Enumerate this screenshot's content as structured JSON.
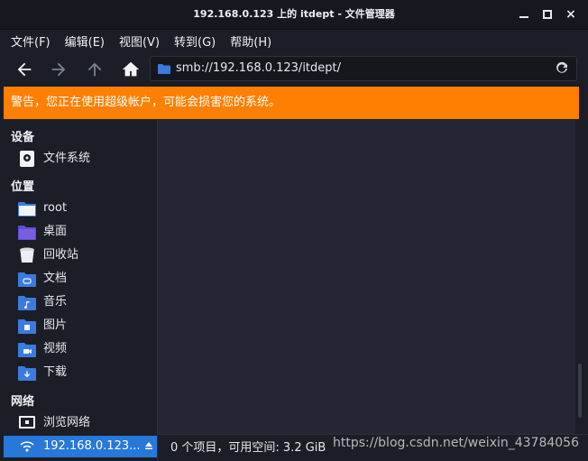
{
  "window": {
    "title": "192.168.0.123 上的 itdept - 文件管理器",
    "close_glyph": "×"
  },
  "menu": [
    {
      "label": "文件(F)"
    },
    {
      "label": "编辑(E)"
    },
    {
      "label": "视图(V)"
    },
    {
      "label": "转到(G)"
    },
    {
      "label": "帮助(H)"
    }
  ],
  "toolbar": {
    "back_icon": "arrow-left-icon",
    "forward_icon": "arrow-right-icon",
    "up_icon": "arrow-up-icon",
    "home_icon": "home-icon",
    "address": "smb://192.168.0.123/itdept/",
    "reload_icon": "reload-icon"
  },
  "warning": {
    "text": "警告，您正在使用超级帐户，可能会损害您的系统。",
    "color": "#fe7f02"
  },
  "sidebar": {
    "devices_title": "设备",
    "devices": [
      {
        "label": "文件系统",
        "icon": "drive-icon"
      }
    ],
    "places_title": "位置",
    "places": [
      {
        "label": "root",
        "icon": "home-folder-icon"
      },
      {
        "label": "桌面",
        "icon": "desktop-folder-icon"
      },
      {
        "label": "回收站",
        "icon": "trash-icon"
      },
      {
        "label": "文档",
        "icon": "documents-folder-icon"
      },
      {
        "label": "音乐",
        "icon": "music-folder-icon"
      },
      {
        "label": "图片",
        "icon": "pictures-folder-icon"
      },
      {
        "label": "视频",
        "icon": "videos-folder-icon"
      },
      {
        "label": "下载",
        "icon": "downloads-folder-icon"
      }
    ],
    "network_title": "网络",
    "network": [
      {
        "label": "浏览网络",
        "icon": "network-icon"
      },
      {
        "label": "192.168.0.123...",
        "icon": "network-share-icon",
        "active": true
      }
    ]
  },
  "status": {
    "text": "0 个项目，可用空间: 3.2 GiB"
  },
  "watermark": "https://blog.csdn.net/weixin_43784056",
  "colors": {
    "accent": "#2778d8",
    "folder": "#3a7be0",
    "background": "#1b1e27",
    "content": "#242733"
  }
}
